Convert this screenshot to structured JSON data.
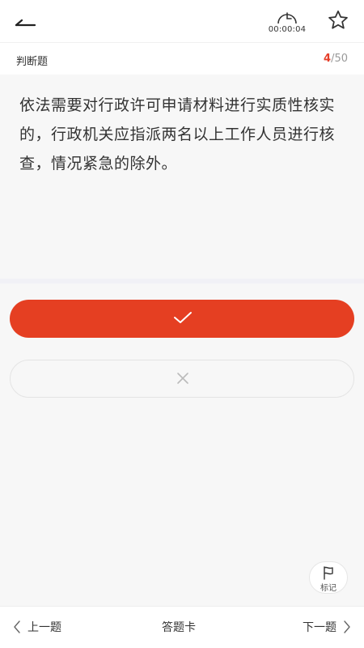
{
  "header": {
    "back_icon": "back-arrow-icon",
    "timer_icon": "clock-icon",
    "timer_text": "00:00:04",
    "favorite_icon": "star-icon"
  },
  "meta": {
    "question_type": "判断题",
    "current": "4",
    "total_text": "/50"
  },
  "question": {
    "text": "依法需要对行政许可申请材料进行实质性核实的，行政机关应指派两名以上工作人员进行核查，情况紧急的除外。"
  },
  "answers": {
    "true_icon": "checkmark-icon",
    "false_icon": "cross-icon",
    "accent_color": "#e53f22"
  },
  "mark": {
    "icon": "flag-icon",
    "label": "标记"
  },
  "footer": {
    "prev_label": "上一题",
    "card_label": "答题卡",
    "next_label": "下一题"
  }
}
